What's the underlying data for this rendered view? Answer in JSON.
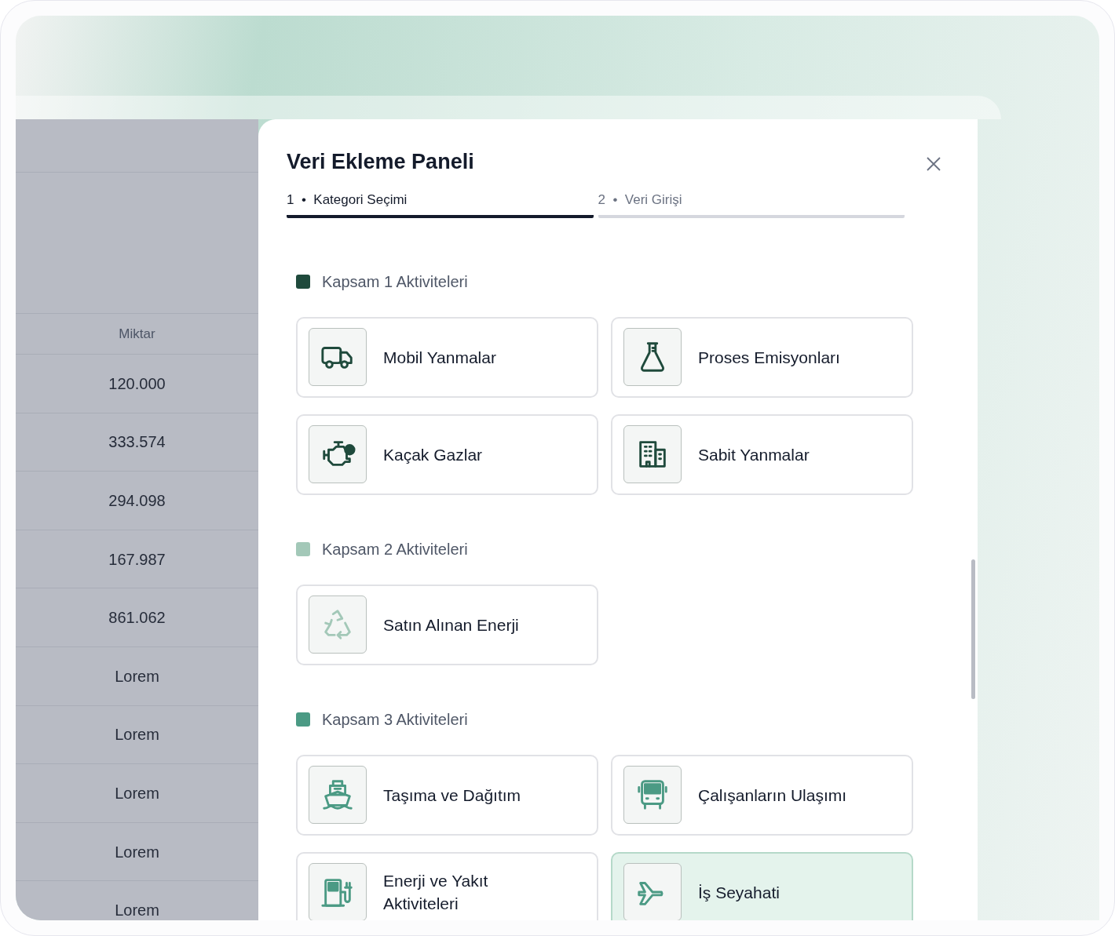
{
  "table": {
    "header": "Miktar",
    "rows": [
      "120.000",
      "333.574",
      "294.098",
      "167.987",
      "861.062",
      "Lorem",
      "Lorem",
      "Lorem",
      "Lorem",
      "Lorem"
    ]
  },
  "modal": {
    "title": "Veri Ekleme Paneli",
    "steps": [
      {
        "number": "1",
        "separator": "•",
        "label": "Kategori Seçimi",
        "selected": true
      },
      {
        "number": "2",
        "separator": "•",
        "label": "Veri Girişi",
        "selected": false
      }
    ],
    "sections": [
      {
        "title": "Kapsam 1 Aktiviteleri",
        "color": "#1f4a3c",
        "items": [
          {
            "label": "Mobil Yanmalar",
            "selected": false
          },
          {
            "label": "Proses Emisyonları",
            "selected": false
          },
          {
            "label": "Kaçak Gazlar",
            "selected": false
          },
          {
            "label": "Sabit Yanmalar",
            "selected": false
          }
        ]
      },
      {
        "title": "Kapsam 2 Aktiviteleri",
        "color": "#a3c8b8",
        "items": [
          {
            "label": "Satın Alınan Enerji",
            "selected": false
          }
        ]
      },
      {
        "title": "Kapsam 3 Aktiviteleri",
        "color": "#4b9a84",
        "items": [
          {
            "label": "Taşıma ve Dağıtım",
            "selected": false
          },
          {
            "label": "Çalışanların Ulaşımı",
            "selected": false
          },
          {
            "label": "Enerji ve Yakıt Aktiviteleri",
            "selected": false
          },
          {
            "label": "İş Seyahati",
            "selected": true
          }
        ]
      }
    ]
  }
}
